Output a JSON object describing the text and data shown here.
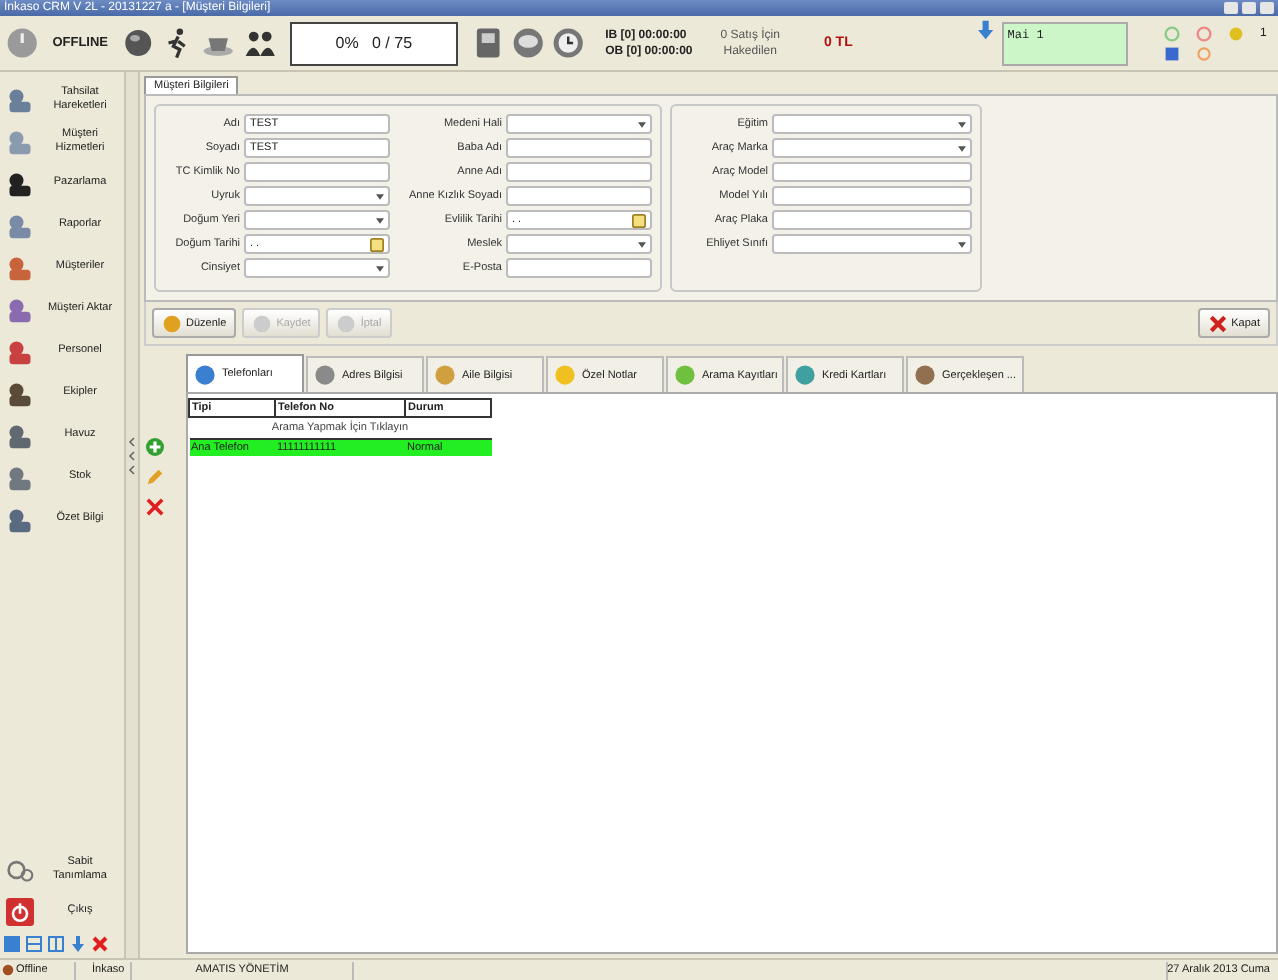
{
  "window": {
    "title": "İnkaso CRM V 2L - 20131227 a - [Müşteri Bilgileri]"
  },
  "toolbar": {
    "status": "OFFLINE",
    "progress": "0%   0 / 75",
    "ib": "IB [0] 00:00:00",
    "ob": "OB [0] 00:00:00",
    "sales": "0 Satış İçin",
    "sales_sub": "Hakedilen",
    "amount": "0 TL",
    "note": "Mai 1",
    "count": "1"
  },
  "sidebar": {
    "items": [
      {
        "label": "Tahsilat Hareketleri"
      },
      {
        "label": "Müşteri Hizmetleri"
      },
      {
        "label": "Pazarlama"
      },
      {
        "label": "Raporlar"
      },
      {
        "label": "Müşteriler"
      },
      {
        "label": "Müşteri Aktar"
      },
      {
        "label": "Personel"
      },
      {
        "label": "Ekipler"
      },
      {
        "label": "Havuz"
      },
      {
        "label": "Stok"
      },
      {
        "label": "Özet Bilgi"
      }
    ],
    "bottom": [
      {
        "label": "Sabit Tanımlama"
      },
      {
        "label": "Çıkış"
      }
    ]
  },
  "form": {
    "tab": "Müşteri Bilgileri",
    "columns": [
      [
        {
          "label": "Adı",
          "value": "TEST",
          "kind": "text"
        },
        {
          "label": "Soyadı",
          "value": "TEST",
          "kind": "text"
        },
        {
          "label": "TC Kimlik No",
          "kind": "text"
        },
        {
          "label": "Uyruk",
          "kind": "select"
        },
        {
          "label": "Doğum Yeri",
          "kind": "select"
        },
        {
          "label": "Doğum Tarihi",
          "value": ". .",
          "kind": "date"
        },
        {
          "label": "Cinsiyet",
          "kind": "select"
        }
      ],
      [
        {
          "label": "Medeni Hali",
          "kind": "select"
        },
        {
          "label": "Baba Adı",
          "kind": "text"
        },
        {
          "label": "Anne Adı",
          "kind": "text"
        },
        {
          "label": "Anne Kızlık Soyadı",
          "kind": "text"
        },
        {
          "label": "Evlilik Tarihi",
          "value": ". .",
          "kind": "date"
        },
        {
          "label": "Meslek",
          "kind": "select"
        },
        {
          "label": "E-Posta",
          "kind": "text"
        }
      ],
      [
        {
          "label": "Eğitim",
          "kind": "select"
        },
        {
          "label": "Araç Marka",
          "kind": "select"
        },
        {
          "label": "Araç Model",
          "kind": "text"
        },
        {
          "label": "Model Yılı",
          "kind": "text"
        },
        {
          "label": "Araç Plaka",
          "kind": "text"
        },
        {
          "label": "Ehliyet Sınıfı",
          "kind": "select"
        }
      ]
    ]
  },
  "actions": [
    {
      "label": "Düzenle",
      "disabled": false
    },
    {
      "label": "Kaydet",
      "disabled": true
    },
    {
      "label": "İptal",
      "disabled": true
    }
  ],
  "close": "Kapat",
  "tabs": [
    {
      "label": "Telefonları",
      "selected": true
    },
    {
      "label": "Adres Bilgisi",
      "selected": false
    },
    {
      "label": "Aile Bilgisi",
      "selected": false
    },
    {
      "label": "Özel Notlar",
      "selected": false
    },
    {
      "label": "Arama Kayıtları",
      "selected": false
    },
    {
      "label": "Kredi Kartları",
      "selected": false
    },
    {
      "label": "Gerçekleşen ...",
      "selected": false
    }
  ],
  "table": {
    "columns": [
      "Tipi",
      "Telefon No",
      "Durum"
    ],
    "hint": "Arama Yapmak İçin Tıklayın",
    "rows": [
      {
        "cells": [
          "Ana Telefon",
          "11111111111",
          "Normal"
        ],
        "selected": true
      }
    ]
  },
  "status_bar": {
    "state": "Offline",
    "app": "İnkaso",
    "user": "AMATIS YÖNETİM",
    "date": "27 Aralık 2013 Cuma"
  }
}
